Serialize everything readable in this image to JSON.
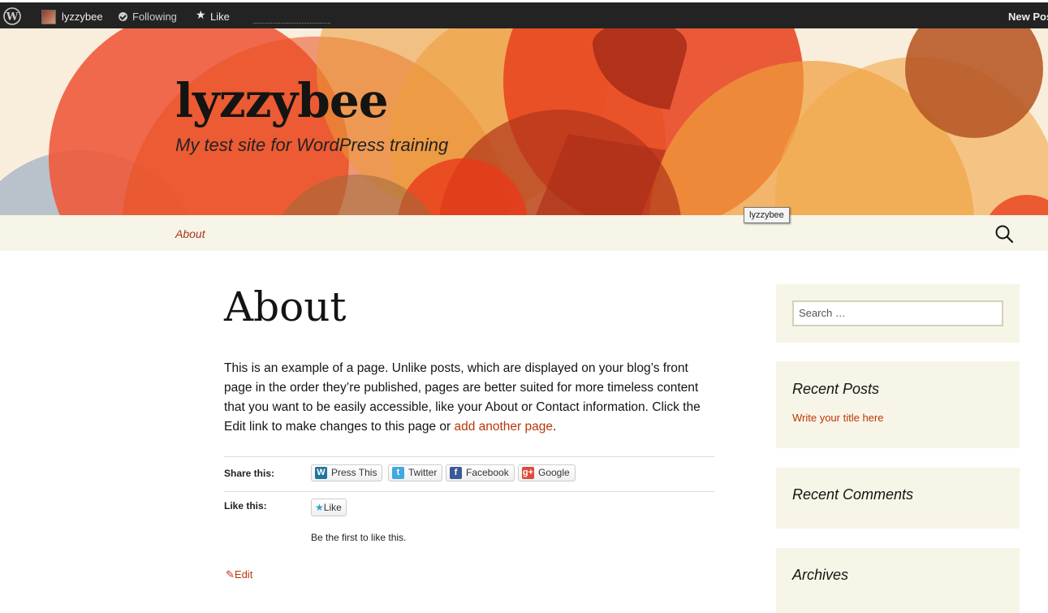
{
  "admin_bar": {
    "user": "lyzzybee",
    "following": "Following",
    "like": "Like",
    "new_post": "New Pos"
  },
  "site": {
    "title": "lyzzybee",
    "description": "My test site for WordPress training"
  },
  "nav": {
    "about": "About",
    "tooltip": "lyzzybee"
  },
  "page": {
    "title": "About",
    "body_text": "This is an example of a page. Unlike posts, which are displayed on your blog’s front page in the order they’re published, pages are better suited for more timeless content that you want to be easily accessible, like your About or Contact information. Click the Edit link to make changes to this page or ",
    "body_link": "add another page",
    "body_end": "."
  },
  "share": {
    "label": "Share this:",
    "buttons": [
      "Press This",
      "Twitter",
      "Facebook",
      "Google"
    ]
  },
  "like": {
    "label": "Like this:",
    "button": "Like",
    "first": "Be the first to like this."
  },
  "edit": "Edit",
  "sidebar": {
    "search_placeholder": "Search …",
    "recent_posts_title": "Recent Posts",
    "recent_post_link": "Write your title here",
    "recent_comments_title": "Recent Comments",
    "archives_title": "Archives"
  }
}
